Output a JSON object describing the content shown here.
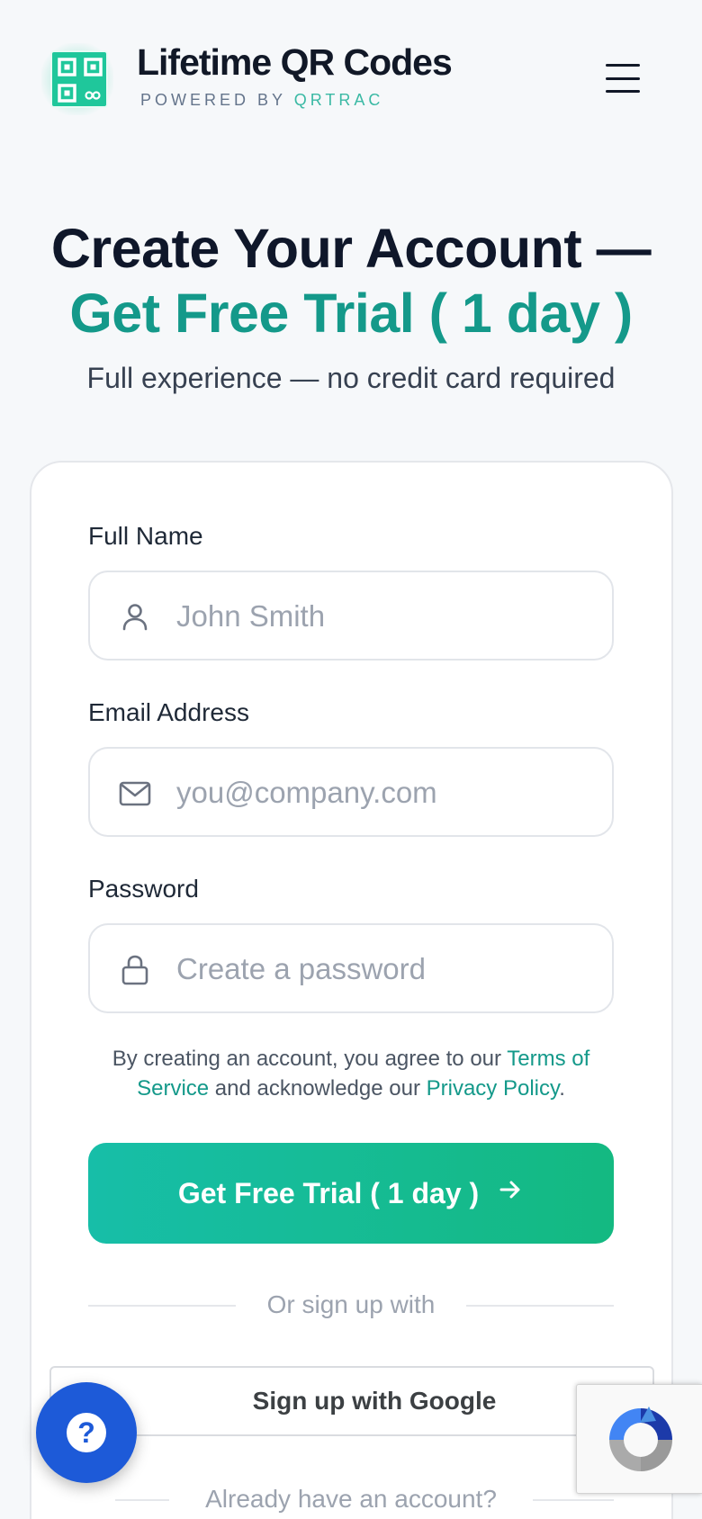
{
  "header": {
    "brand_title": "Lifetime QR Codes",
    "brand_powered_by": "POWERED BY",
    "brand_company": "QRTRAC",
    "menu_icon": "hamburger-menu-icon",
    "logo_icon": "qr-code-icon"
  },
  "hero": {
    "title_line1": "Create Your Account —",
    "title_line2": "Get Free Trial ( 1 day )",
    "subtitle": "Full experience — no credit card required"
  },
  "form": {
    "full_name": {
      "label": "Full Name",
      "placeholder": "John Smith",
      "value": "",
      "icon": "user-icon"
    },
    "email": {
      "label": "Email Address",
      "placeholder": "you@company.com",
      "value": "",
      "icon": "mail-icon"
    },
    "password": {
      "label": "Password",
      "placeholder": "Create a password",
      "value": "",
      "icon": "lock-icon"
    },
    "terms": {
      "prefix": "By creating an account, you agree to our ",
      "terms_link": "Terms of Service",
      "middle": " and acknowledge our ",
      "privacy_link": "Privacy Policy",
      "suffix": "."
    },
    "submit_label": "Get Free Trial ( 1 day )",
    "submit_icon": "arrow-right-icon",
    "divider_text": "Or sign up with",
    "google_label": "Sign up with Google",
    "login_prompt": "Already have an account?"
  },
  "widgets": {
    "help_icon": "question-mark-icon",
    "recaptcha_icon": "recaptcha-logo-icon"
  },
  "colors": {
    "accent": "#14998a",
    "button_gradient_start": "#17bea8",
    "button_gradient_end": "#14b981",
    "help_button": "#1d5ad8"
  }
}
